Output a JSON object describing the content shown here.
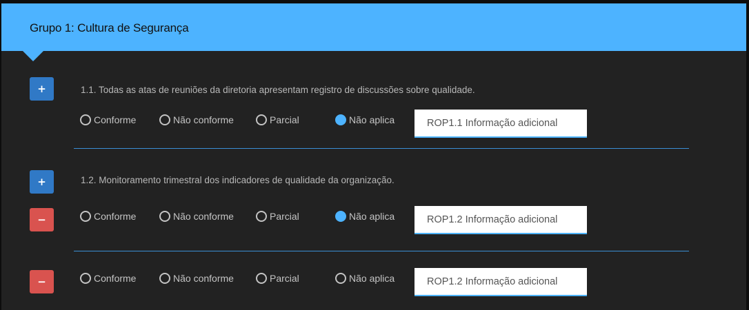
{
  "group": {
    "title": "Grupo 1: Cultura de Segurança"
  },
  "options": [
    "Conforme",
    "Não conforme",
    "Parcial",
    "Não aplica"
  ],
  "colors": {
    "accent": "#4db3ff",
    "plus": "#3079c6",
    "minus": "#d9534f"
  },
  "icons": {
    "plus": "plus-icon",
    "minus": "minus-icon"
  },
  "buttons": {
    "plus": "+",
    "minus": "−"
  },
  "items": [
    {
      "question": "1.1. Todas as atas de reuniões da diretoria apresentam registro de discussões sobre qualidade.",
      "selected": "Não aplica",
      "info_value": "ROP1.1 Informação adicional"
    },
    {
      "question": "1.2. Monitoramento trimestral dos indicadores de qualidade da organização.",
      "selected": "Não aplica",
      "info_value": "ROP1.2 Informação adicional"
    },
    {
      "question": "",
      "selected": "",
      "info_value": "ROP1.2 Informação adicional"
    }
  ]
}
